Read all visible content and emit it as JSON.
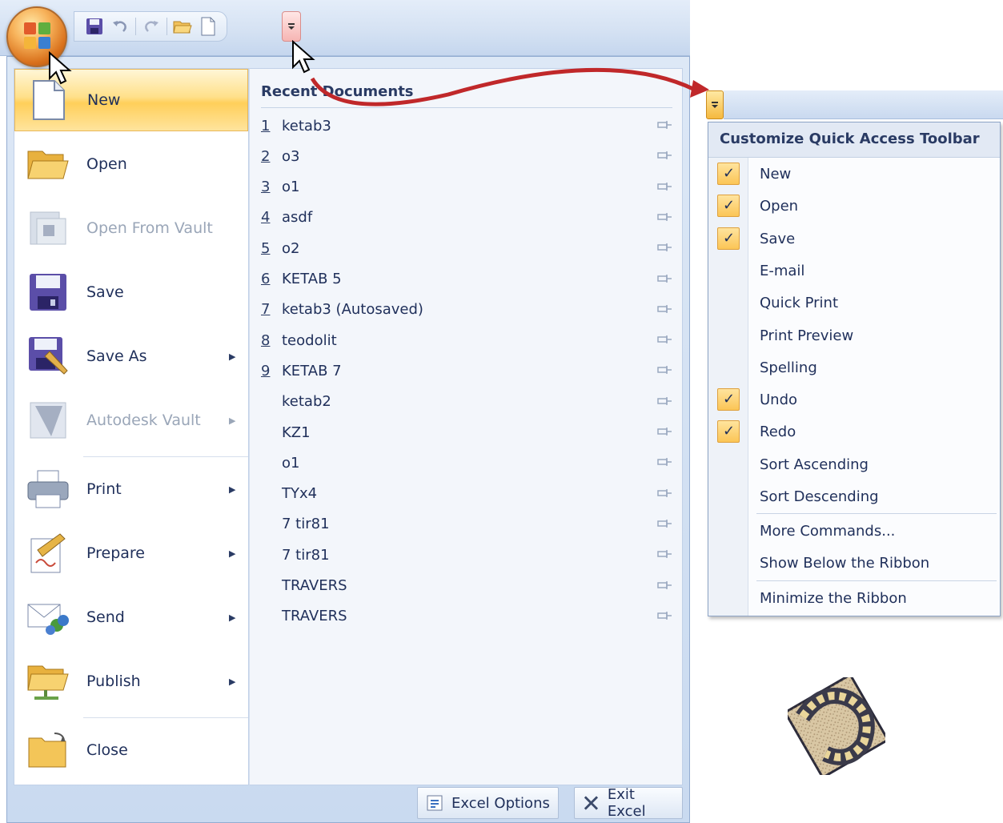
{
  "window": {
    "qat_buttons": [
      "save-icon",
      "undo-icon",
      "redo-icon",
      "open-icon",
      "new-icon"
    ]
  },
  "office_menu": {
    "commands": [
      {
        "label": "New",
        "icon": "new-document-icon",
        "active": true,
        "submenu": false,
        "disabled": false
      },
      {
        "label": "Open",
        "icon": "open-folder-icon",
        "active": false,
        "submenu": false,
        "disabled": false
      },
      {
        "label": "Open From Vault",
        "icon": "vault-icon",
        "active": false,
        "submenu": false,
        "disabled": true
      },
      {
        "label": "Save",
        "icon": "save-icon",
        "active": false,
        "submenu": false,
        "disabled": false
      },
      {
        "label": "Save As",
        "icon": "save-as-icon",
        "active": false,
        "submenu": true,
        "disabled": false
      },
      {
        "label": "Autodesk Vault",
        "icon": "autodesk-vault-icon",
        "active": false,
        "submenu": true,
        "disabled": true
      },
      {
        "label": "Print",
        "icon": "printer-icon",
        "active": false,
        "submenu": true,
        "disabled": false
      },
      {
        "label": "Prepare",
        "icon": "prepare-icon",
        "active": false,
        "submenu": true,
        "disabled": false
      },
      {
        "label": "Send",
        "icon": "send-icon",
        "active": false,
        "submenu": true,
        "disabled": false
      },
      {
        "label": "Publish",
        "icon": "publish-icon",
        "active": false,
        "submenu": true,
        "disabled": false
      },
      {
        "label": "Close",
        "icon": "close-folder-icon",
        "active": false,
        "submenu": false,
        "disabled": false
      }
    ],
    "recent_title": "Recent Documents",
    "recent_documents": [
      {
        "num": "1",
        "name": "ketab3"
      },
      {
        "num": "2",
        "name": "o3"
      },
      {
        "num": "3",
        "name": "o1"
      },
      {
        "num": "4",
        "name": "asdf"
      },
      {
        "num": "5",
        "name": "o2"
      },
      {
        "num": "6",
        "name": "KETAB 5"
      },
      {
        "num": "7",
        "name": "ketab3 (Autosaved)"
      },
      {
        "num": "8",
        "name": "teodolit"
      },
      {
        "num": "9",
        "name": "KETAB 7"
      },
      {
        "num": "",
        "name": "ketab2"
      },
      {
        "num": "",
        "name": "KZ1"
      },
      {
        "num": "",
        "name": "o1"
      },
      {
        "num": "",
        "name": "TYx4"
      },
      {
        "num": "",
        "name": "7 tir81"
      },
      {
        "num": "",
        "name": "7 tir81"
      },
      {
        "num": "",
        "name": "TRAVERS"
      },
      {
        "num": "",
        "name": "TRAVERS"
      }
    ],
    "footer": {
      "options_label": "Excel Options",
      "exit_label": "Exit Excel"
    }
  },
  "customize_qat": {
    "title": "Customize Quick Access Toolbar",
    "items": [
      {
        "label": "New",
        "checked": true
      },
      {
        "label": "Open",
        "checked": true
      },
      {
        "label": "Save",
        "checked": true
      },
      {
        "label": "E-mail",
        "checked": false
      },
      {
        "label": "Quick Print",
        "checked": false
      },
      {
        "label": "Print Preview",
        "checked": false
      },
      {
        "label": "Spelling",
        "checked": false
      },
      {
        "label": "Undo",
        "checked": true
      },
      {
        "label": "Redo",
        "checked": true
      },
      {
        "label": "Sort Ascending",
        "checked": false
      },
      {
        "label": "Sort Descending",
        "checked": false
      }
    ],
    "more_commands": "More Commands...",
    "show_below": "Show Below the Ribbon",
    "minimize": "Minimize the Ribbon"
  },
  "colors": {
    "accent_orange": "#ffcf5a",
    "text_navy": "#1f2f5a",
    "arrow_red": "#c0282a"
  }
}
